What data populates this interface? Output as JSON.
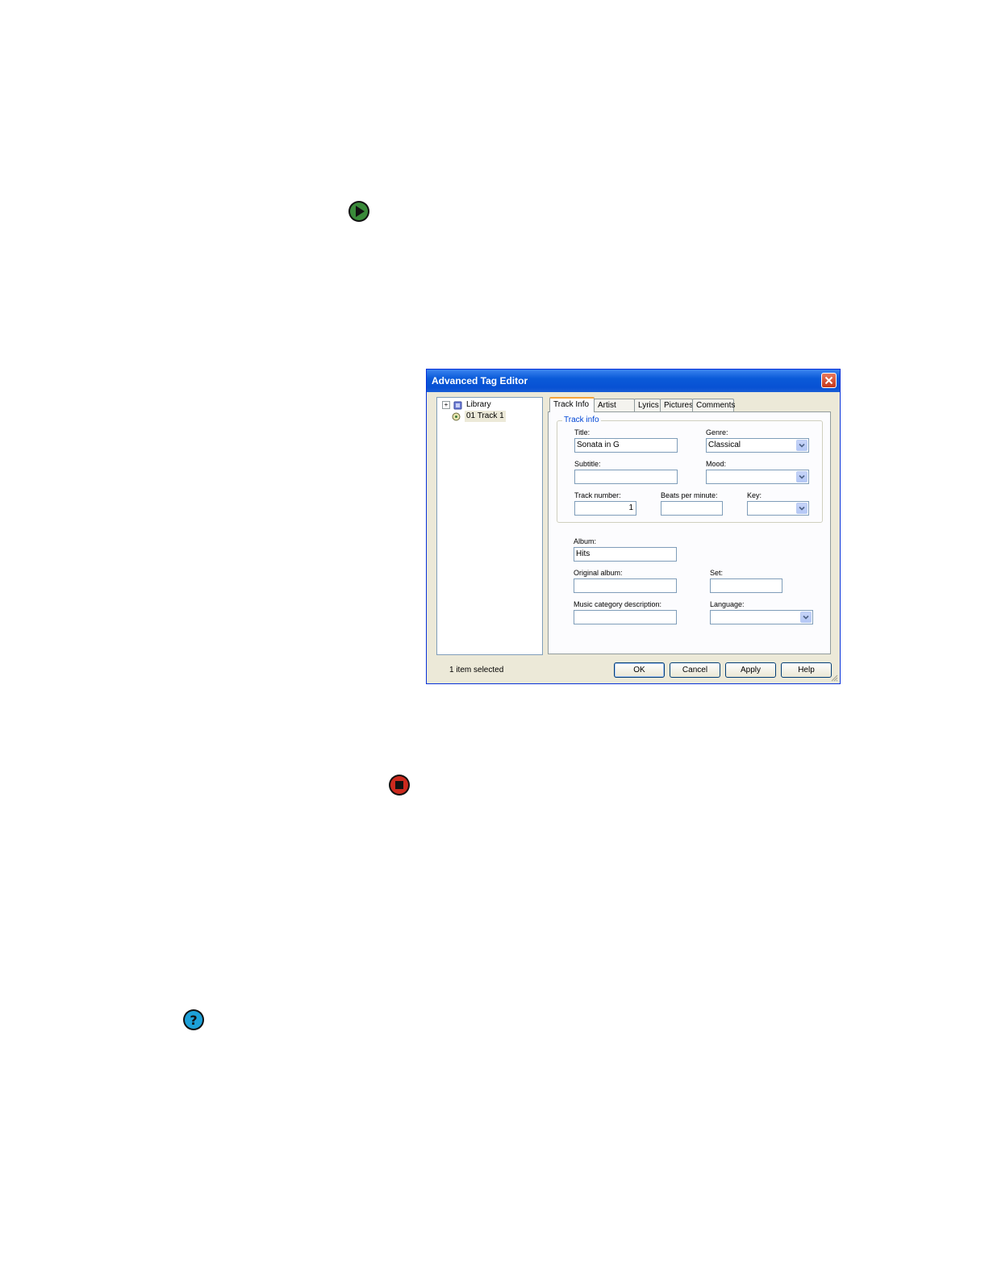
{
  "dialog": {
    "title": "Advanced Tag Editor",
    "tree": {
      "root_label": "Library",
      "expander": "+",
      "child_label": "01 Track 1"
    },
    "tabs": [
      "Track Info",
      "Artist Info",
      "Lyrics",
      "Pictures",
      "Comments"
    ],
    "active_tab": "Track Info",
    "track_info_group": {
      "legend": "Track info",
      "title_label": "Title:",
      "title_value": "Sonata in G",
      "genre_label": "Genre:",
      "genre_value": "Classical",
      "subtitle_label": "Subtitle:",
      "subtitle_value": "",
      "mood_label": "Mood:",
      "mood_value": "",
      "track_number_label": "Track number:",
      "track_number_value": "1",
      "bpm_label": "Beats per minute:",
      "bpm_value": "",
      "key_label": "Key:",
      "key_value": ""
    },
    "album_label": "Album:",
    "album_value": "Hits",
    "original_album_label": "Original album:",
    "original_album_value": "",
    "set_label": "Set:",
    "set_value": "",
    "music_category_label": "Music category description:",
    "music_category_value": "",
    "language_label": "Language:",
    "language_value": "",
    "status": "1 item selected",
    "buttons": {
      "ok": "OK",
      "cancel": "Cancel",
      "apply": "Apply",
      "help": "Help"
    }
  },
  "icons": {
    "play": "play-icon",
    "stop": "stop-icon",
    "help": "help-icon"
  },
  "colors": {
    "play": "#3a8a3a",
    "stop": "#cc2a1e",
    "help": "#1da0d8",
    "titlebar": "#0a5ad8",
    "dialog_bg": "#ece9d8"
  }
}
